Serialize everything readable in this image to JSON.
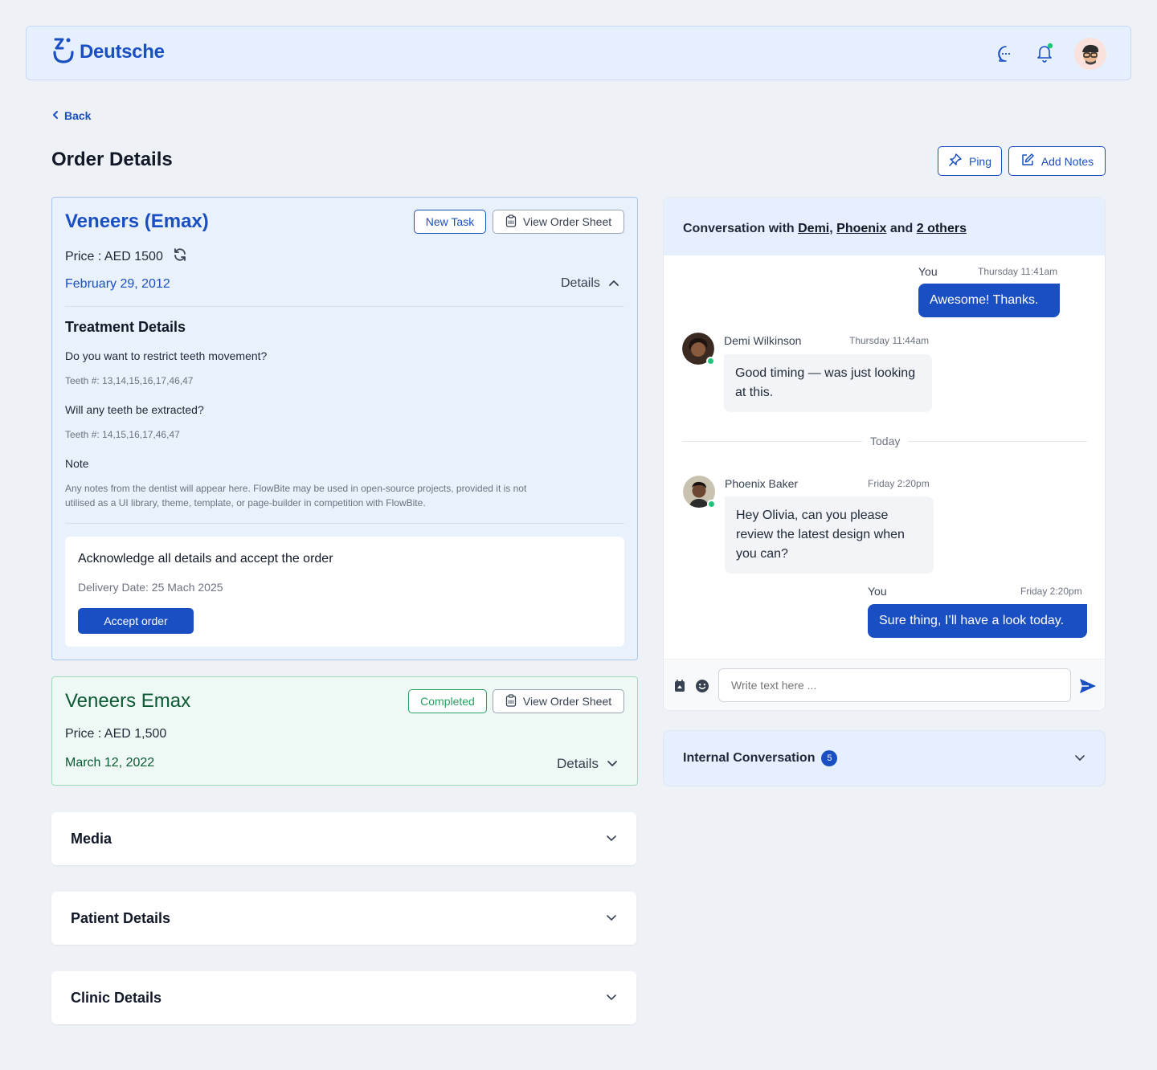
{
  "brand": {
    "name": "Deutsche",
    "color": "#1a4fc4"
  },
  "header": {
    "icons": [
      "chat-icon",
      "bell-icon",
      "user-avatar"
    ],
    "notification_dot": true
  },
  "nav": {
    "back_label": "Back"
  },
  "page": {
    "title": "Order Details",
    "ping_label": "Ping",
    "add_notes_label": "Add Notes"
  },
  "order1": {
    "title": "Veneers (Emax)",
    "new_task_label": "New Task",
    "view_sheet_label": "View Order Sheet",
    "price": "Price : AED 1500",
    "date": "February 29, 2012",
    "details_label": "Details",
    "treatment_title": "Treatment Details",
    "q1": "Do you want to restrict teeth movement?",
    "q1_teeth": "Teeth #: 13,14,15,16,17,46,47",
    "q2": "Will any teeth be extracted?",
    "q2_teeth": "Teeth #: 14,15,16,17,46,47",
    "note_label": "Note",
    "note_body": "Any notes from the dentist will appear here. FlowBite may be used in open-source projects, provided it is not utilised as a UI library, theme, template, or page-builder in competition with FlowBite.",
    "ack_title": "Acknowledge all details and accept the order",
    "delivery": "Delivery Date: 25 Mach 2025",
    "accept_label": "Accept order"
  },
  "order2": {
    "title": "Veneers Emax",
    "status": "Completed",
    "view_sheet_label": "View Order Sheet",
    "price": "Price : AED 1,500",
    "date": "March 12, 2022",
    "details_label": "Details"
  },
  "accordions": {
    "media": "Media",
    "patient": "Patient Details",
    "clinic": "Clinic Details"
  },
  "conversation": {
    "prefix": "Conversation with ",
    "p1": "Demi",
    "sep": ", ",
    "p2": "Phoenix",
    "and": " and ",
    "others": "2 others",
    "messages": [
      {
        "author": "You",
        "time": "Thursday 11:41am",
        "text": "Awesome! Thanks."
      },
      {
        "author": "Demi Wilkinson",
        "time": "Thursday 11:44am",
        "text": "Good timing — was just looking at this."
      },
      {
        "author": "Phoenix Baker",
        "time": "Friday 2:20pm",
        "text": "Hey Olivia, can you please review the latest design when you can?"
      },
      {
        "author": "You",
        "time": "Friday 2:20pm",
        "text": "Sure thing, I’ll have a look today."
      }
    ],
    "divider": "Today",
    "input_placeholder": "Write text here ..."
  },
  "internal": {
    "title": "Internal Conversation",
    "count": "5"
  }
}
